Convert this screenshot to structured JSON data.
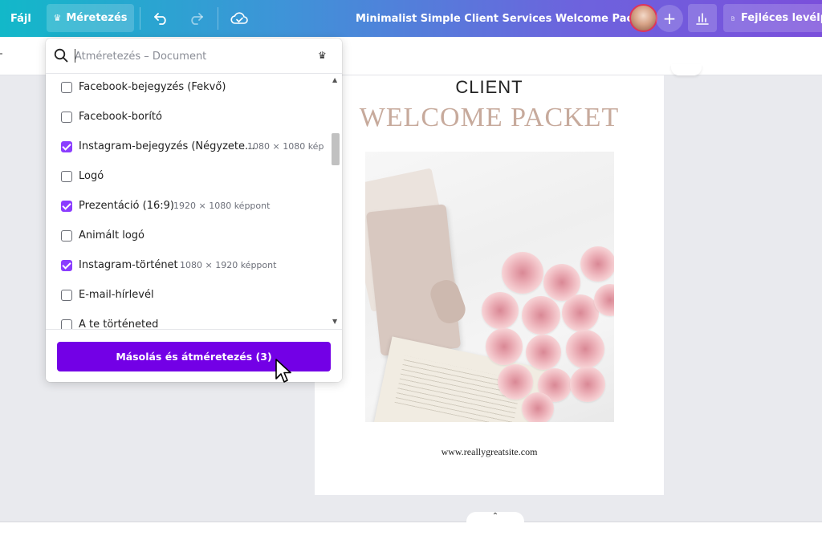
{
  "topbar": {
    "file_label": "Fájl",
    "resize_label": "Méretezés",
    "doc_title": "Minimalist Simple Client Services Welcome Packet",
    "template_label": "Fejléces levélp",
    "icons": [
      "crown-icon",
      "undo-icon",
      "redo-icon",
      "cloud-save-icon",
      "plus-icon",
      "stats-icon",
      "document-icon"
    ]
  },
  "resize_menu": {
    "search_placeholder": "Átméretezés – Document",
    "items": [
      {
        "label": "Facebook-bejegyzés (Fekvő)",
        "checked": false,
        "dims": ""
      },
      {
        "label": "Facebook-borító",
        "checked": false,
        "dims": ""
      },
      {
        "label": "Instagram-bejegyzés (Négyzete...",
        "checked": true,
        "dims": "1080 × 1080 kép"
      },
      {
        "label": "Logó",
        "checked": false,
        "dims": ""
      },
      {
        "label": "Prezentáció (16:9)",
        "checked": true,
        "dims": "1920 × 1080 képpont"
      },
      {
        "label": "Animált logó",
        "checked": false,
        "dims": ""
      },
      {
        "label": "Instagram-történet",
        "checked": true,
        "dims": "1080 × 1920 képpont"
      },
      {
        "label": "E-mail-hírlevél",
        "checked": false,
        "dims": ""
      },
      {
        "label": "A te történeted",
        "checked": false,
        "dims": ""
      }
    ],
    "copy_button": "Másolás és átméretezés (3)"
  },
  "canvas": {
    "client": "CLIENT",
    "welcome": "WELCOME PACKET",
    "url": "www.reallygreatsite.com"
  },
  "bottom": {
    "collapse_label": "⌃"
  },
  "colors": {
    "brand_purple": "#7300e6",
    "checkbox_checked": "#8b3dff",
    "title_accent": "#c7aa9c"
  }
}
